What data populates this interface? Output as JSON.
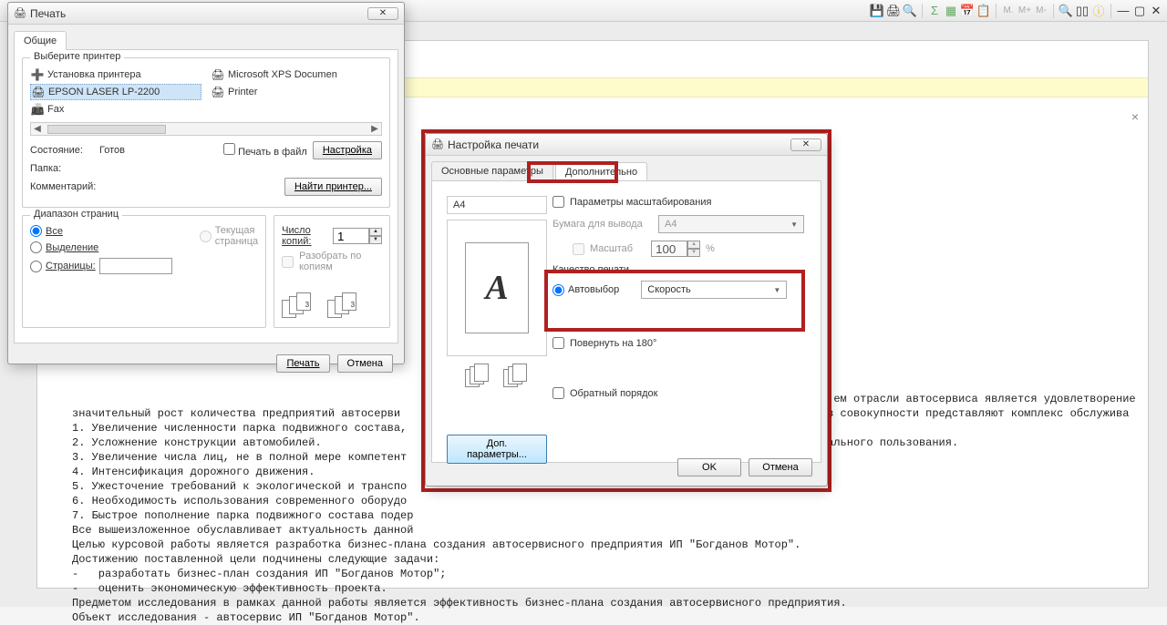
{
  "toolbar": {
    "m_half": "M.",
    "m_plus": "M+",
    "m_minus": "M-"
  },
  "doc": {
    "close": "×",
    "text": "                                                                                                                    ем отрасли автосервиса является удовлетворение\nзначительный рост количества предприятий автосерви                                                                 в совокупности представляют комплекс обслужива\n1. Увеличение численности парка подвижного состава,\n2. Усложнение конструкции автомобилей.                                                                             ального пользования.\n3. Увеличение числа лиц, не в полной мере компетент\n4. Интенсификация дорожного движения.\n5. Ужесточение требований к экологической и транспо\n6. Необходимость использования современного оборудо\n7. Быстрое пополнение парка подвижного состава подер\nВсе вышеизложенное обуславливает актуальность данной\nЦелью курсовой работы является разработка бизнес-плана создания автосервисного предприятия ИП \"Богданов Мотор\".\nДостижению поставленной цели подчинены следующие задачи:\n-   разработать бизнес-план создания ИП \"Богданов Мотор\";\n-   оценить экономическую эффективность проекта.\nПредметом исследования в рамках данной работы является эффективность бизнес-плана создания автосервисного предприятия.\nОбъект исследования - автосервис ИП \"Богданов Мотор\"."
  },
  "print": {
    "title": "Печать",
    "close": "✕",
    "tab": "Общие",
    "group_printer": "Выберите принтер",
    "printers": {
      "setup": "Установка принтера",
      "epson": "EPSON LASER LP-2200",
      "fax": "Fax",
      "xps": "Microsoft XPS Documen",
      "printer": "Printer"
    },
    "state_lbl": "Состояние:",
    "state_val": "Готов",
    "folder_lbl": "Папка:",
    "comment_lbl": "Комментарий:",
    "to_file": "Печать в файл",
    "settings_btn": "Настройка",
    "find_btn": "Найти принтер...",
    "range_group": "Диапазон страниц",
    "range_all": "Все",
    "range_sel": "Выделение",
    "range_pages": "Страницы:",
    "range_cur": "Текущая страница",
    "copies_lbl": "Число копий:",
    "copies_val": "1",
    "collate": "Разобрать по копиям",
    "print_btn": "Печать",
    "cancel_btn": "Отмена"
  },
  "settings": {
    "title": "Настройка печати",
    "tab_main": "Основные параметры",
    "tab_more": "Дополнительно",
    "paper": "A4",
    "scale_params": "Параметры масштабирования",
    "output_paper": "Бумага для вывода",
    "output_val": "A4",
    "scale_lbl": "Масштаб",
    "scale_val": "100",
    "percent": "%",
    "quality_lbl": "Качество печати",
    "quality_auto": "Автовыбор",
    "quality_val": "Скорость",
    "rotate": "Повернуть на 180°",
    "params_btn": "Доп. параметры...",
    "reverse": "Обратный порядок",
    "ok": "OK",
    "cancel": "Отмена",
    "preview_letter": "A"
  }
}
